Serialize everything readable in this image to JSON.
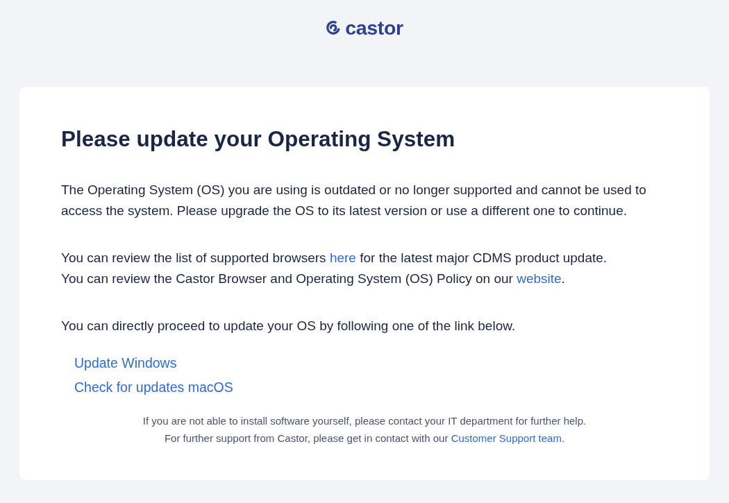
{
  "header": {
    "logo_text": "castor"
  },
  "card": {
    "title": "Please update your Operating System",
    "sections": [
      {
        "lines": [
          {
            "parts": [
              {
                "kind": "text",
                "text": "The Operating System (OS) you are using is outdated or no longer supported and cannot be used to access the system. Please upgrade the OS to its latest version or use a different one to continue."
              }
            ]
          }
        ]
      },
      {
        "lines": [
          {
            "parts": [
              {
                "kind": "text",
                "text": "You can review the list of supported browsers "
              },
              {
                "kind": "link",
                "text": "here"
              },
              {
                "kind": "text",
                "text": " for the latest major CDMS product update."
              }
            ]
          },
          {
            "parts": [
              {
                "kind": "text",
                "text": "You can review the Castor Browser and Operating System (OS) Policy on our "
              },
              {
                "kind": "link",
                "text": "website"
              },
              {
                "kind": "text",
                "text": "."
              }
            ]
          }
        ]
      },
      {
        "lines": [
          {
            "parts": [
              {
                "kind": "text",
                "text": "You can directly proceed to update your OS by following one of the link below."
              }
            ]
          }
        ]
      }
    ],
    "links": [
      {
        "text": "Update Windows"
      },
      {
        "text": "Check for updates macOS"
      }
    ],
    "footer": {
      "lines": [
        {
          "parts": [
            {
              "kind": "text",
              "text": "If you are not able to install software yourself, please contact your IT department for further help."
            }
          ]
        },
        {
          "parts": [
            {
              "kind": "text",
              "text": "For further support from Castor, please get in contact with our "
            },
            {
              "kind": "link",
              "text": "Customer Support team"
            },
            {
              "kind": "text",
              "text": "."
            }
          ]
        }
      ]
    }
  }
}
